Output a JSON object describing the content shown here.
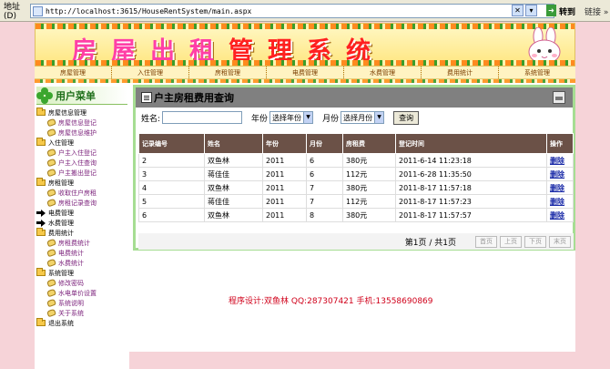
{
  "browser": {
    "address_label": "地址(D)",
    "url": "http://localhost:3615/HouseRentSystem/main.aspx",
    "go_label": "转到",
    "links_label": "链接 »"
  },
  "banner": {
    "title_main": "房屋出租",
    "title_sub": "管理系统"
  },
  "nav": {
    "items": [
      {
        "label": "房屋管理"
      },
      {
        "label": "入住管理"
      },
      {
        "label": "房租管理"
      },
      {
        "label": "电费管理"
      },
      {
        "label": "水费管理"
      },
      {
        "label": "费用统计"
      },
      {
        "label": "系统管理"
      }
    ]
  },
  "sidebar": {
    "header": "用户菜单",
    "groups": [
      {
        "label": "房屋信息管理",
        "icon": "folder-icon",
        "items": [
          "房屋信息登记",
          "房屋信息维护"
        ]
      },
      {
        "label": "入住管理",
        "icon": "folder-icon",
        "items": [
          "户主入住登记",
          "户主入住查询",
          "户主搬出登记"
        ]
      },
      {
        "label": "房租管理",
        "icon": "folder-icon",
        "items": [
          "收取住户房租",
          "房租记录查询"
        ]
      },
      {
        "label": "电费管理",
        "icon": "arrow-icon",
        "items": []
      },
      {
        "label": "水费管理",
        "icon": "arrow-icon",
        "items": []
      },
      {
        "label": "费用统计",
        "icon": "folder-icon",
        "items": [
          "房租费统计",
          "电费统计",
          "水费统计"
        ]
      },
      {
        "label": "系统管理",
        "icon": "folder-icon",
        "items": [
          "修改密码",
          "水电单价设置",
          "系统说明",
          "关于系统"
        ]
      },
      {
        "label": "退出系统",
        "icon": "folder-icon",
        "items": []
      }
    ]
  },
  "query": {
    "title": "户主房租费用查询",
    "name_label": "姓名:",
    "name_value": "",
    "year_label": "年份",
    "year_selected": "选择年份",
    "month_label": "月份",
    "month_selected": "选择月份",
    "search_label": "查询"
  },
  "table": {
    "headers": [
      "记录编号",
      "姓名",
      "年份",
      "月份",
      "房租费",
      "登记时间",
      "操作"
    ],
    "rows": [
      [
        "2",
        "双鱼林",
        "2011",
        "6",
        "380元",
        "2011-6-14 11:23:18",
        "删除"
      ],
      [
        "3",
        "蒋佳佳",
        "2011",
        "6",
        "112元",
        "2011-6-28 11:35:50",
        "删除"
      ],
      [
        "4",
        "双鱼林",
        "2011",
        "7",
        "380元",
        "2011-8-17 11:57:18",
        "删除"
      ],
      [
        "5",
        "蒋佳佳",
        "2011",
        "7",
        "112元",
        "2011-8-17 11:57:23",
        "删除"
      ],
      [
        "6",
        "双鱼林",
        "2011",
        "8",
        "380元",
        "2011-8-17 11:57:57",
        "删除"
      ]
    ]
  },
  "pager": {
    "text": "第1页 / 共1页",
    "first": "首页",
    "prev": "上页",
    "next": "下页",
    "last": "末页"
  },
  "footer": {
    "credit": "程序设计:双鱼林 QQ:287307421 手机:13558690869"
  },
  "colors": {
    "page_bg": "#f6d3d8",
    "title_pink": "#ff3fa6",
    "header_brown": "#6b5147",
    "border_green": "#a6dd93",
    "credit_red": "#d0001a"
  }
}
